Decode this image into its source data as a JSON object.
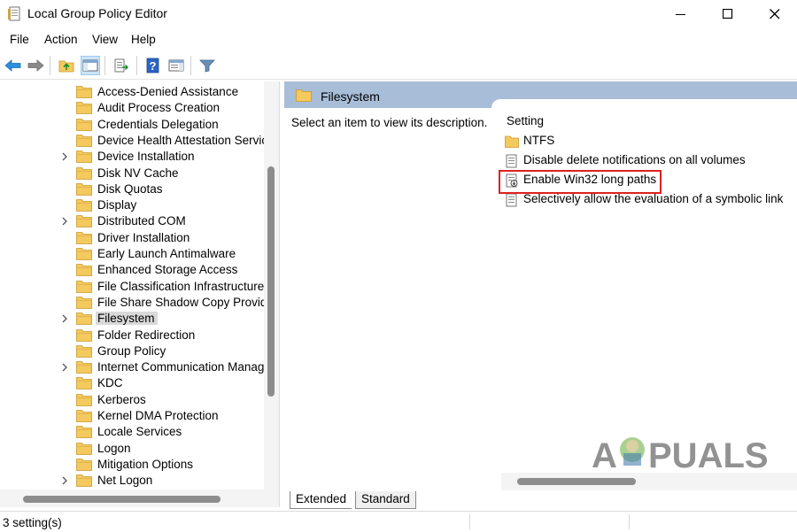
{
  "window": {
    "title": "Local Group Policy Editor",
    "minimize_glyph": "minimize-icon",
    "maximize_glyph": "maximize-icon",
    "close_glyph": "close-icon"
  },
  "menu": {
    "file": "File",
    "action": "Action",
    "view": "View",
    "help": "Help"
  },
  "tree": {
    "items": [
      {
        "label": "Access-Denied Assistance",
        "expandable": false
      },
      {
        "label": "Audit Process Creation",
        "expandable": false
      },
      {
        "label": "Credentials Delegation",
        "expandable": false
      },
      {
        "label": "Device Health Attestation Service",
        "expandable": false
      },
      {
        "label": "Device Installation",
        "expandable": true
      },
      {
        "label": "Disk NV Cache",
        "expandable": false
      },
      {
        "label": "Disk Quotas",
        "expandable": false
      },
      {
        "label": "Display",
        "expandable": false
      },
      {
        "label": "Distributed COM",
        "expandable": true
      },
      {
        "label": "Driver Installation",
        "expandable": false
      },
      {
        "label": "Early Launch Antimalware",
        "expandable": false
      },
      {
        "label": "Enhanced Storage Access",
        "expandable": false
      },
      {
        "label": "File Classification Infrastructure",
        "expandable": false
      },
      {
        "label": "File Share Shadow Copy Provider",
        "expandable": false
      },
      {
        "label": "Filesystem",
        "expandable": true,
        "selected": true
      },
      {
        "label": "Folder Redirection",
        "expandable": false
      },
      {
        "label": "Group Policy",
        "expandable": false
      },
      {
        "label": "Internet Communication Management",
        "expandable": true
      },
      {
        "label": "KDC",
        "expandable": false
      },
      {
        "label": "Kerberos",
        "expandable": false
      },
      {
        "label": "Kernel DMA Protection",
        "expandable": false
      },
      {
        "label": "Locale Services",
        "expandable": false
      },
      {
        "label": "Logon",
        "expandable": false
      },
      {
        "label": "Mitigation Options",
        "expandable": false
      },
      {
        "label": "Net Logon",
        "expandable": true
      }
    ]
  },
  "right_pane": {
    "header_title": "Filesystem",
    "description": "Select an item to view its description.",
    "column_header": "Setting",
    "settings": [
      {
        "label": "NTFS",
        "kind": "folder"
      },
      {
        "label": "Disable delete notifications on all volumes",
        "kind": "policy"
      },
      {
        "label": "Enable Win32 long paths",
        "kind": "policy-enabled",
        "highlighted": true
      },
      {
        "label": "Selectively allow the evaluation of a symbolic link",
        "kind": "policy"
      }
    ]
  },
  "tabs": {
    "extended": "Extended",
    "standard": "Standard"
  },
  "status": {
    "text": "3 setting(s)"
  },
  "colors": {
    "header_bg": "#a8bdd8",
    "folder_yellow": "#f4c95d",
    "highlight_red": "#e02020",
    "selection_gray": "#d9d9d9"
  }
}
